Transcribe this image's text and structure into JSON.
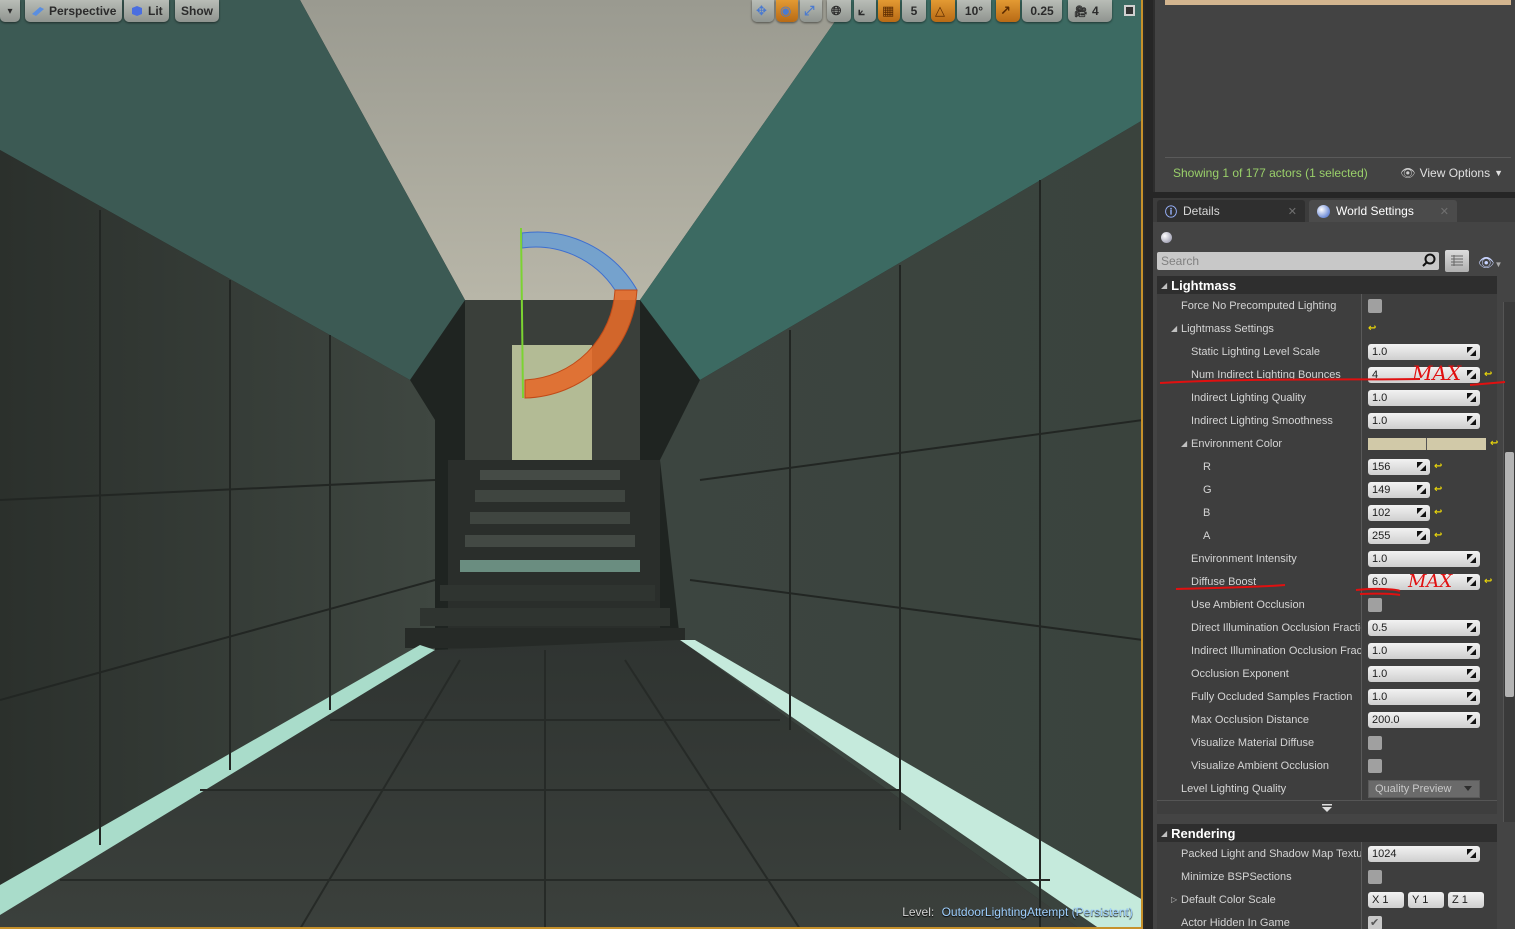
{
  "viewport": {
    "menu_toggle": "▾",
    "perspective_label": "Perspective",
    "view_mode_label": "Lit",
    "show_label": "Show",
    "grid_snap_value": "5",
    "rotation_snap_value": "10°",
    "scale_snap_value": "0.25",
    "camera_speed_value": "4",
    "level_prefix": "Level:",
    "level_name": "OutdoorLightingAttempt (Persistent)"
  },
  "outliner": {
    "status_text": "Showing 1 of 177 actors (1 selected)",
    "view_options_label": "View Options"
  },
  "details": {
    "tabs": [
      {
        "label": "Details",
        "icon": "info-icon",
        "active": false
      },
      {
        "label": "World Settings",
        "icon": "globe-icon",
        "active": true
      }
    ],
    "search_placeholder": "Search",
    "categories": {
      "lightmass": "Lightmass",
      "rendering": "Rendering"
    },
    "lightmass": {
      "force_no_precomputed": {
        "label": "Force No Precomputed Lighting",
        "checked": false
      },
      "settings_label": "Lightmass Settings",
      "static_level_scale": {
        "label": "Static Lighting Level Scale",
        "value": "1.0"
      },
      "num_bounces": {
        "label": "Num Indirect Lighting Bounces",
        "value": "4"
      },
      "indirect_quality": {
        "label": "Indirect Lighting Quality",
        "value": "1.0"
      },
      "indirect_smoothness": {
        "label": "Indirect Lighting Smoothness",
        "value": "1.0"
      },
      "environment_color": {
        "label": "Environment Color",
        "swatch": "#d1c9a8",
        "r": {
          "label": "R",
          "value": "156"
        },
        "g": {
          "label": "G",
          "value": "149"
        },
        "b": {
          "label": "B",
          "value": "102"
        },
        "a": {
          "label": "A",
          "value": "255"
        }
      },
      "environment_intensity": {
        "label": "Environment Intensity",
        "value": "1.0"
      },
      "diffuse_boost": {
        "label": "Diffuse Boost",
        "value": "6.0"
      },
      "use_ao": {
        "label": "Use Ambient Occlusion",
        "checked": false
      },
      "direct_occlusion_frac": {
        "label": "Direct Illumination Occlusion Fraction",
        "value": "0.5"
      },
      "indirect_occlusion_frac": {
        "label": "Indirect Illumination Occlusion Fraction",
        "value": "1.0"
      },
      "occlusion_exponent": {
        "label": "Occlusion Exponent",
        "value": "1.0"
      },
      "fully_occluded_frac": {
        "label": "Fully Occluded Samples Fraction",
        "value": "1.0"
      },
      "max_occlusion_distance": {
        "label": "Max Occlusion Distance",
        "value": "200.0"
      },
      "visualize_material_diffuse": {
        "label": "Visualize Material Diffuse",
        "checked": false
      },
      "visualize_ao": {
        "label": "Visualize Ambient Occlusion",
        "checked": false
      },
      "level_lighting_quality": {
        "label": "Level Lighting Quality",
        "value": "Quality Preview"
      }
    },
    "rendering": {
      "packed_map_size": {
        "label": "Packed Light and Shadow Map Texture Size",
        "value": "1024"
      },
      "minimize_bsp": {
        "label": "Minimize BSPSections",
        "checked": false
      },
      "default_color_scale": {
        "label": "Default Color Scale",
        "x": "X 1",
        "y": "Y 1",
        "z": "Z 1"
      },
      "actor_hidden": {
        "label": "Actor Hidden In Game",
        "checked": true
      }
    }
  },
  "annotations": {
    "bounces_note": "MAX",
    "diffuse_note": "MAX",
    "color": "#e01010"
  }
}
